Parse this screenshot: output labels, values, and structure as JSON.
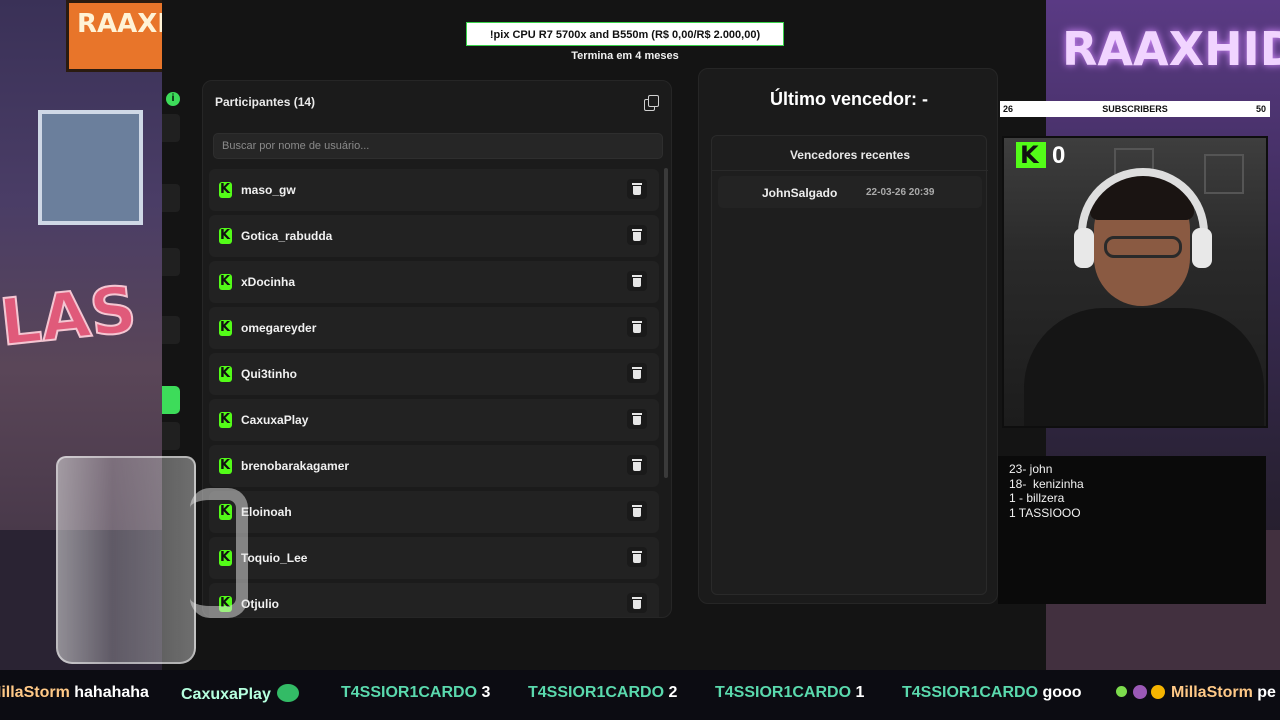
{
  "background": {
    "left_sign": "RAAXHID",
    "left_graffiti": "LAS",
    "right_neon": "RAAXHID"
  },
  "giveaway": {
    "title": "!pix CPU R7 5700x and B550m (R$ 0,00/R$ 2.000,00)",
    "subtitle": "Termina em 4 meses"
  },
  "participants": {
    "header": "Participantes (14)",
    "search_placeholder": "Buscar por nome de usuário...",
    "items": [
      {
        "name": "maso_gw"
      },
      {
        "name": "Gotica_rabudda"
      },
      {
        "name": "xDocinha"
      },
      {
        "name": "omegareyder"
      },
      {
        "name": "Qui3tinho"
      },
      {
        "name": "CaxuxaPlay"
      },
      {
        "name": "brenobarakagamer"
      },
      {
        "name": "Eloinoah"
      },
      {
        "name": "Toquio_Lee"
      },
      {
        "name": "Otjulio"
      }
    ]
  },
  "winner": {
    "title": "Último vencedor: -",
    "recent_title": "Vencedores recentes",
    "recent": [
      {
        "name": "JohnSalgado",
        "date": "22-03-26 20:39"
      }
    ]
  },
  "subscribers_bar": {
    "current": "26",
    "label": "SUBSCRIBERS",
    "goal": "50",
    "progress": 0.52
  },
  "kick_counter": {
    "value": "0"
  },
  "notes": [
    "23- john",
    "18-  kenizinha",
    "1 - billzera",
    "1 TASSIOOO"
  ],
  "ticker": [
    {
      "user": "MillaStorm",
      "message": "hahahaha"
    },
    {
      "user": "CaxuxaPlay",
      "message": ""
    },
    {
      "user": "T4SSIOR1CARDO",
      "message": "3"
    },
    {
      "user": "T4SSIOR1CARDO",
      "message": "2"
    },
    {
      "user": "T4SSIOR1CARDO",
      "message": "1"
    },
    {
      "user": "T4SSIOR1CARDO",
      "message": "gooo"
    },
    {
      "user": "MillaStorm",
      "message": "pe"
    }
  ],
  "colors": {
    "kick_green": "#53fc18",
    "panel_bg": "#1b1b1b",
    "row_bg": "#222222"
  }
}
